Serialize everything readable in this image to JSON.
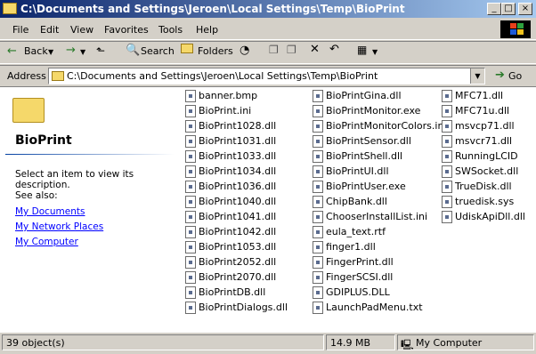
{
  "window": {
    "title": "C:\\Documents and Settings\\Jeroen\\Local Settings\\Temp\\BioPrint",
    "minimize_glyph": "_",
    "maximize_glyph": "□",
    "close_glyph": "×"
  },
  "menu": [
    "File",
    "Edit",
    "View",
    "Favorites",
    "Tools",
    "Help"
  ],
  "toolbar": {
    "back_label": "Back",
    "search_label": "Search",
    "folders_label": "Folders"
  },
  "address": {
    "label": "Address",
    "value": "C:\\Documents and Settings\\Jeroen\\Local Settings\\Temp\\BioPrint",
    "go_label": "Go"
  },
  "left_panel": {
    "folder_name": "BioPrint",
    "description": "Select an item to view its description.",
    "see_also": "See also:",
    "links": [
      "My Documents",
      "My Network Places",
      "My Computer"
    ]
  },
  "files": {
    "col1": [
      "banner.bmp",
      "BioPrint.ini",
      "BioPrint1028.dll",
      "BioPrint1031.dll",
      "BioPrint1033.dll",
      "BioPrint1034.dll",
      "BioPrint1036.dll",
      "BioPrint1040.dll",
      "BioPrint1041.dll",
      "BioPrint1042.dll",
      "BioPrint1053.dll",
      "BioPrint2052.dll",
      "BioPrint2070.dll",
      "BioPrintDB.dll",
      "BioPrintDialogs.dll"
    ],
    "col2": [
      "BioPrintGina.dll",
      "BioPrintMonitor.exe",
      "BioPrintMonitorColors.ini",
      "BioPrintSensor.dll",
      "BioPrintShell.dll",
      "BioPrintUI.dll",
      "BioPrintUser.exe",
      "ChipBank.dll",
      "ChooserInstallList.ini",
      "eula_text.rtf",
      "finger1.dll",
      "FingerPrint.dll",
      "FingerSCSI.dll",
      "GDIPLUS.DLL",
      "LaunchPadMenu.txt"
    ],
    "col3": [
      "MFC71.dll",
      "MFC71u.dll",
      "msvcp71.dll",
      "msvcr71.dll",
      "RunningLCID",
      "SWSocket.dll",
      "TrueDisk.dll",
      "truedisk.sys",
      "UdiskApiDll.dll"
    ]
  },
  "status": {
    "objects": "39 object(s)",
    "size": "14.9 MB",
    "location": "My Computer"
  },
  "colors": {
    "title_start": "#0a246a",
    "title_end": "#a6caf0",
    "face": "#d4d0c8",
    "link": "#0000ff"
  }
}
